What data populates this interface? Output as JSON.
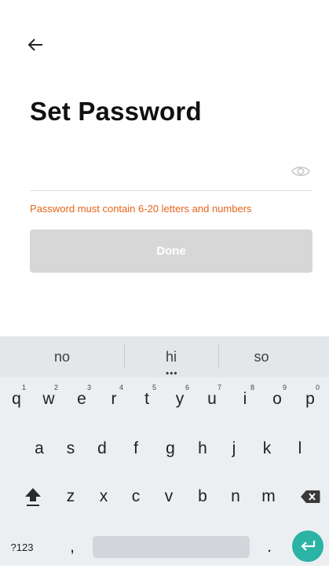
{
  "header": {
    "title": "Set Password"
  },
  "form": {
    "password_value": "",
    "password_placeholder": "",
    "hint": "Password must contain 6-20 letters and numbers",
    "done_label": "Done"
  },
  "keyboard": {
    "suggestions": [
      "no",
      "hi",
      "so"
    ],
    "row1": [
      {
        "k": "q",
        "n": "1"
      },
      {
        "k": "w",
        "n": "2"
      },
      {
        "k": "e",
        "n": "3"
      },
      {
        "k": "r",
        "n": "4"
      },
      {
        "k": "t",
        "n": "5"
      },
      {
        "k": "y",
        "n": "6"
      },
      {
        "k": "u",
        "n": "7"
      },
      {
        "k": "i",
        "n": "8"
      },
      {
        "k": "o",
        "n": "9"
      },
      {
        "k": "p",
        "n": "0"
      }
    ],
    "row2": [
      "a",
      "s",
      "d",
      "f",
      "g",
      "h",
      "j",
      "k",
      "l"
    ],
    "row3": [
      "z",
      "x",
      "c",
      "v",
      "b",
      "n",
      "m"
    ],
    "symbols_label": "?123",
    "comma_label": ",",
    "period_label": "."
  },
  "colors": {
    "hint": "#e8641b",
    "done_bg": "#d7d7d7",
    "enter_bg": "#2bb3a5"
  },
  "icons": {
    "back": "arrow-left-icon",
    "eye": "eye-icon",
    "shift": "shift-icon",
    "backspace": "backspace-icon",
    "enter": "enter-icon"
  }
}
